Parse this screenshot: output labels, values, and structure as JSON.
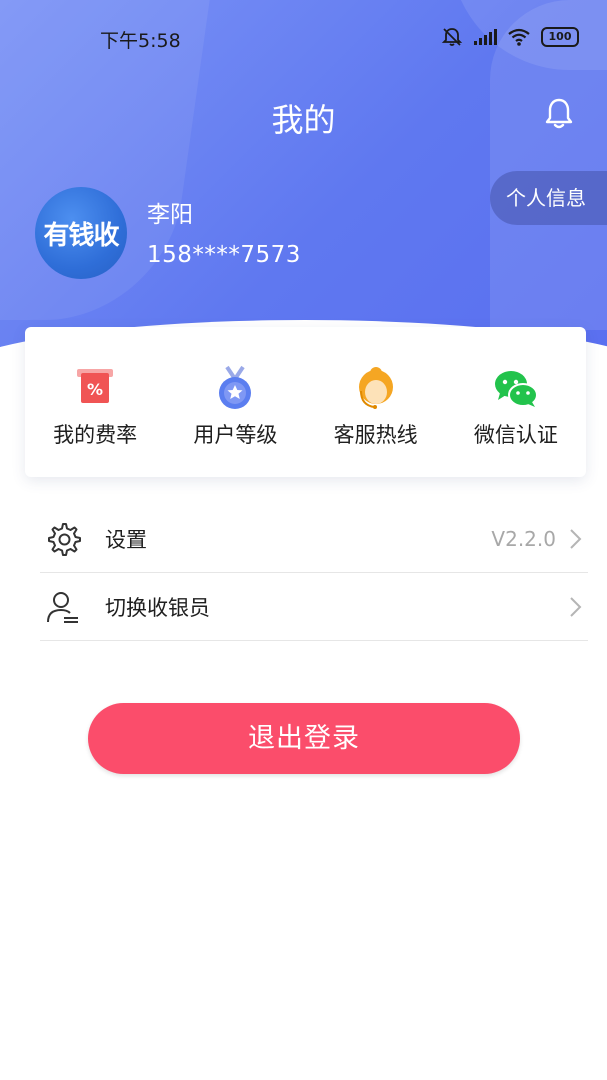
{
  "status_bar": {
    "time": "下午5:58",
    "battery": "100"
  },
  "header": {
    "title": "我的"
  },
  "profile": {
    "avatar_text": "有钱收",
    "name": "李阳",
    "phone": "158****7573",
    "info_button": "个人信息"
  },
  "quick_actions": [
    {
      "label": "我的费率",
      "icon": "rate-tag-icon"
    },
    {
      "label": "用户等级",
      "icon": "medal-icon"
    },
    {
      "label": "客服热线",
      "icon": "customer-service-icon"
    },
    {
      "label": "微信认证",
      "icon": "wechat-icon"
    }
  ],
  "menu": {
    "settings": {
      "label": "设置",
      "value": "V2.2.0"
    },
    "switch_cashier": {
      "label": "切换收银员"
    }
  },
  "logout_label": "退出登录",
  "colors": {
    "header_gradient_start": "#7b93f6",
    "header_gradient_end": "#5a6ff0",
    "logout": "#fb4d6b",
    "wechat": "#22c34c",
    "rate_red": "#f05454",
    "medal_blue": "#5b7ef0",
    "service_orange": "#f5a623"
  }
}
